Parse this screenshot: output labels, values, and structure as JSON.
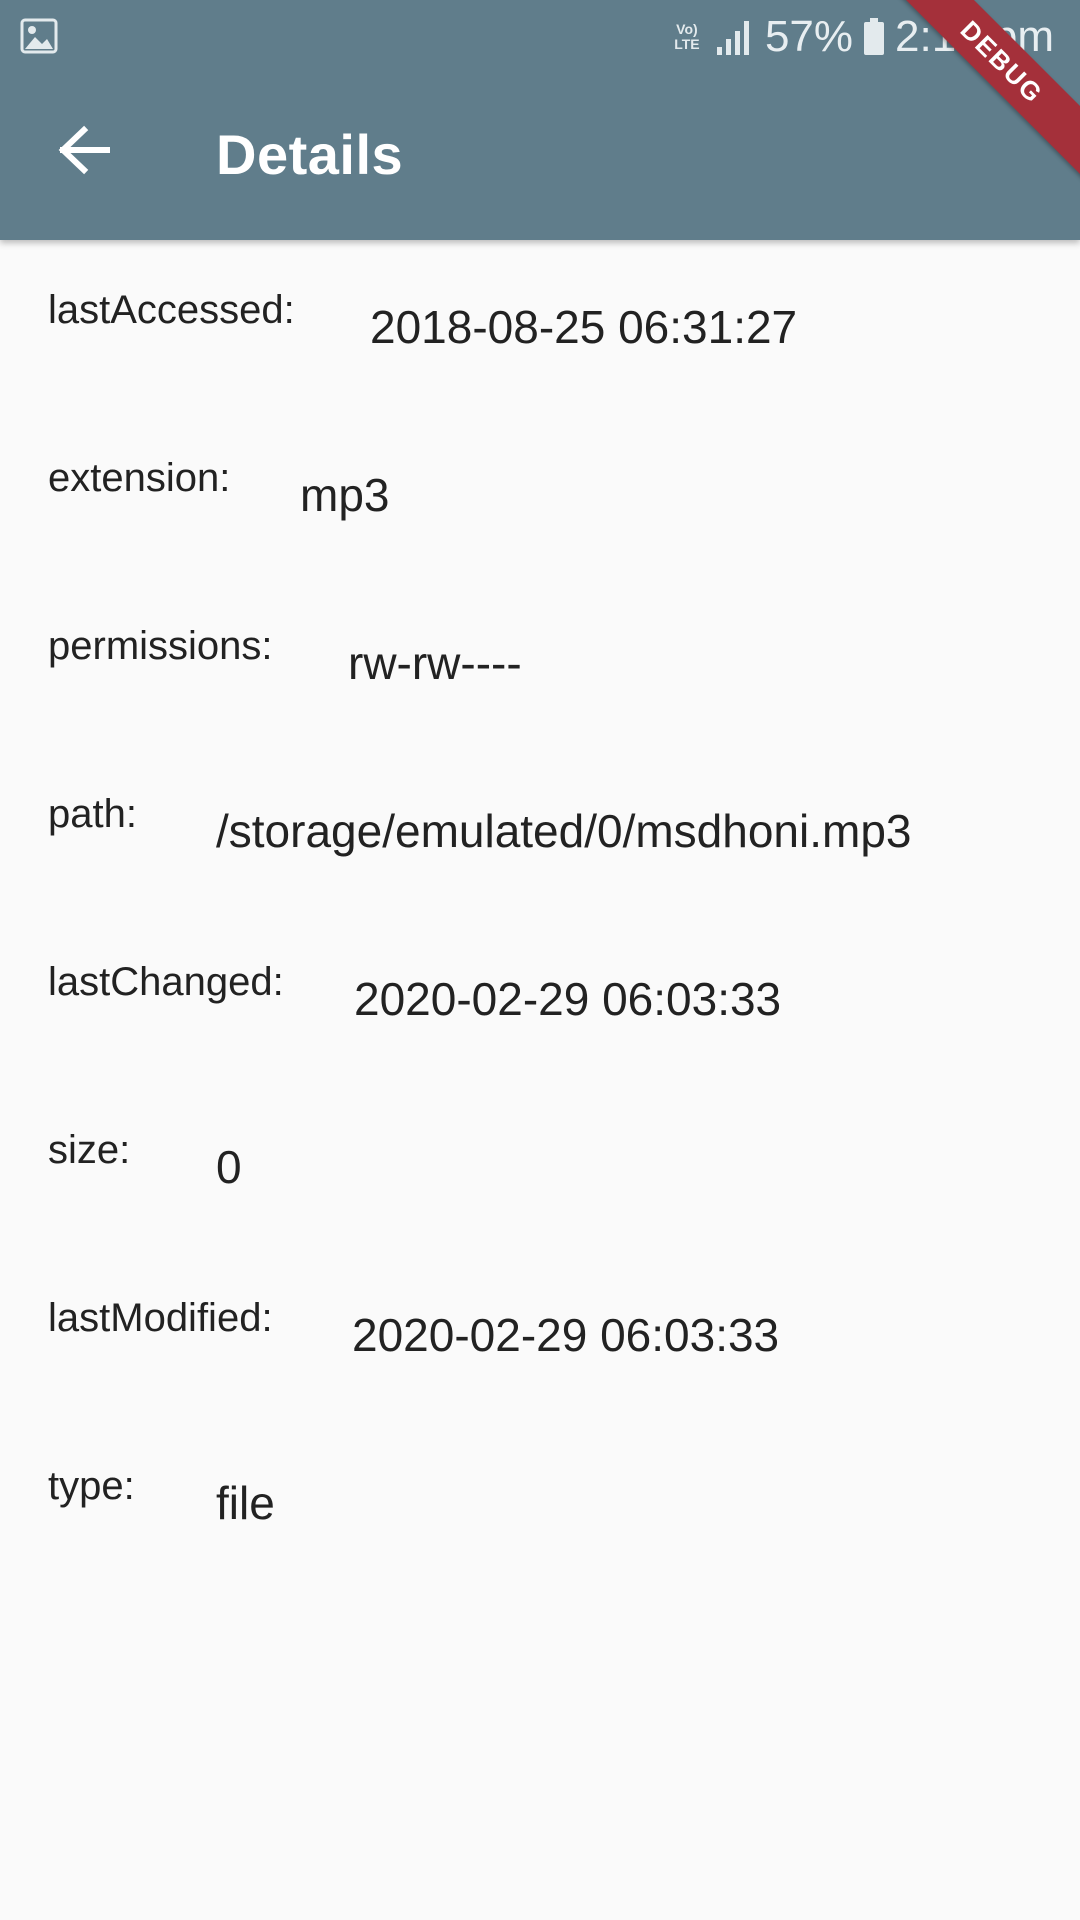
{
  "status_bar": {
    "network": "Vo) LTE",
    "battery_percent": "57%",
    "time": "2:13 pm",
    "icons": [
      "gallery-icon",
      "signal-icon",
      "battery-icon"
    ]
  },
  "toolbar": {
    "back_icon": "arrow-back-icon",
    "title": "Details",
    "banner": "DEBUG",
    "background_color": "#607d8b",
    "banner_color": "#a4303a"
  },
  "details": [
    {
      "key": "lastAccessed:",
      "value": "2018-08-25 06:31:27"
    },
    {
      "key": "extension:",
      "value": "mp3"
    },
    {
      "key": "permissions:",
      "value": "rw-rw----"
    },
    {
      "key": "path:",
      "value": "/storage/emulated/0/msdhoni.mp3"
    },
    {
      "key": "lastChanged:",
      "value": "2020-02-29 06:03:33"
    },
    {
      "key": "size:",
      "value": "0"
    },
    {
      "key": "lastModified:",
      "value": "2020-02-29 06:03:33"
    },
    {
      "key": "type:",
      "value": "file"
    }
  ]
}
